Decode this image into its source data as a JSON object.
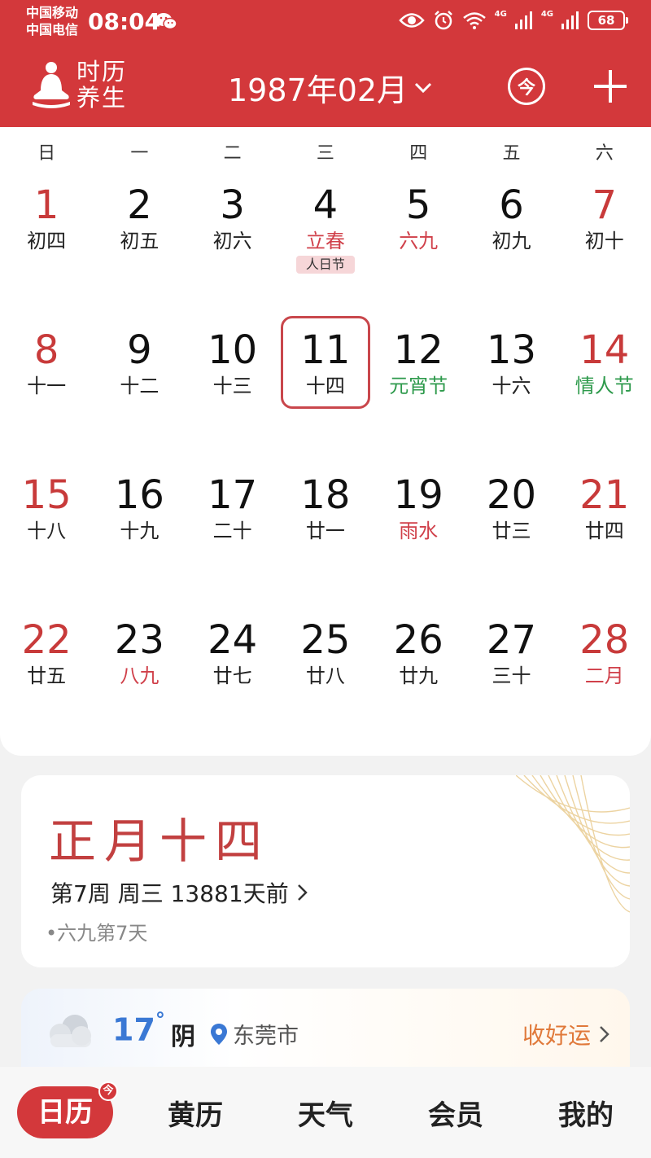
{
  "status_bar": {
    "carrier_1": "中国移动",
    "carrier_2": "中国电信",
    "time": "08:04",
    "net_1": "4G",
    "net_2": "4G",
    "battery": "68"
  },
  "header": {
    "brand_line1": "时历",
    "brand_line2": "养生",
    "month_title": "1987年02月",
    "today_label": "今"
  },
  "calendar": {
    "weekdays": [
      "日",
      "一",
      "二",
      "三",
      "四",
      "五",
      "六"
    ],
    "weeks": [
      [
        {
          "day": "1",
          "lunar": "初四",
          "day_red": true
        },
        {
          "day": "2",
          "lunar": "初五"
        },
        {
          "day": "3",
          "lunar": "初六"
        },
        {
          "day": "4",
          "lunar": "立春",
          "lunar_style": "red",
          "tag": "人日节"
        },
        {
          "day": "5",
          "lunar": "六九",
          "lunar_style": "red"
        },
        {
          "day": "6",
          "lunar": "初九"
        },
        {
          "day": "7",
          "lunar": "初十",
          "day_red": true
        }
      ],
      [
        {
          "day": "8",
          "lunar": "十一",
          "day_red": true
        },
        {
          "day": "9",
          "lunar": "十二"
        },
        {
          "day": "10",
          "lunar": "十三"
        },
        {
          "day": "11",
          "lunar": "十四",
          "selected": true
        },
        {
          "day": "12",
          "lunar": "元宵节",
          "lunar_style": "green"
        },
        {
          "day": "13",
          "lunar": "十六"
        },
        {
          "day": "14",
          "lunar": "情人节",
          "lunar_style": "green",
          "day_red": true
        }
      ],
      [
        {
          "day": "15",
          "lunar": "十八",
          "day_red": true
        },
        {
          "day": "16",
          "lunar": "十九"
        },
        {
          "day": "17",
          "lunar": "二十"
        },
        {
          "day": "18",
          "lunar": "廿一"
        },
        {
          "day": "19",
          "lunar": "雨水",
          "lunar_style": "red"
        },
        {
          "day": "20",
          "lunar": "廿三"
        },
        {
          "day": "21",
          "lunar": "廿四",
          "day_red": true
        }
      ],
      [
        {
          "day": "22",
          "lunar": "廿五",
          "day_red": true
        },
        {
          "day": "23",
          "lunar": "八九",
          "lunar_style": "red"
        },
        {
          "day": "24",
          "lunar": "廿七"
        },
        {
          "day": "25",
          "lunar": "廿八"
        },
        {
          "day": "26",
          "lunar": "廿九"
        },
        {
          "day": "27",
          "lunar": "三十"
        },
        {
          "day": "28",
          "lunar": "二月",
          "lunar_style": "red",
          "day_red": true
        }
      ]
    ]
  },
  "info_card": {
    "lunar_date": "正月十四",
    "week_info": "第7周 周三 13881天前",
    "nine_info": "•六九第7天"
  },
  "weather": {
    "temp": "17",
    "degree": "°",
    "condition": "阴",
    "location": "东莞市",
    "fortune": "收好运"
  },
  "bottom_nav": {
    "items": [
      "日历",
      "黄历",
      "天气",
      "会员",
      "我的"
    ],
    "badge": "今"
  },
  "colors": {
    "brand_red": "#d3383b",
    "holiday_red": "#c83a3a",
    "festival_green": "#2e9a4c",
    "temp_blue": "#3a78d4",
    "fortune_orange": "#e0793a"
  }
}
